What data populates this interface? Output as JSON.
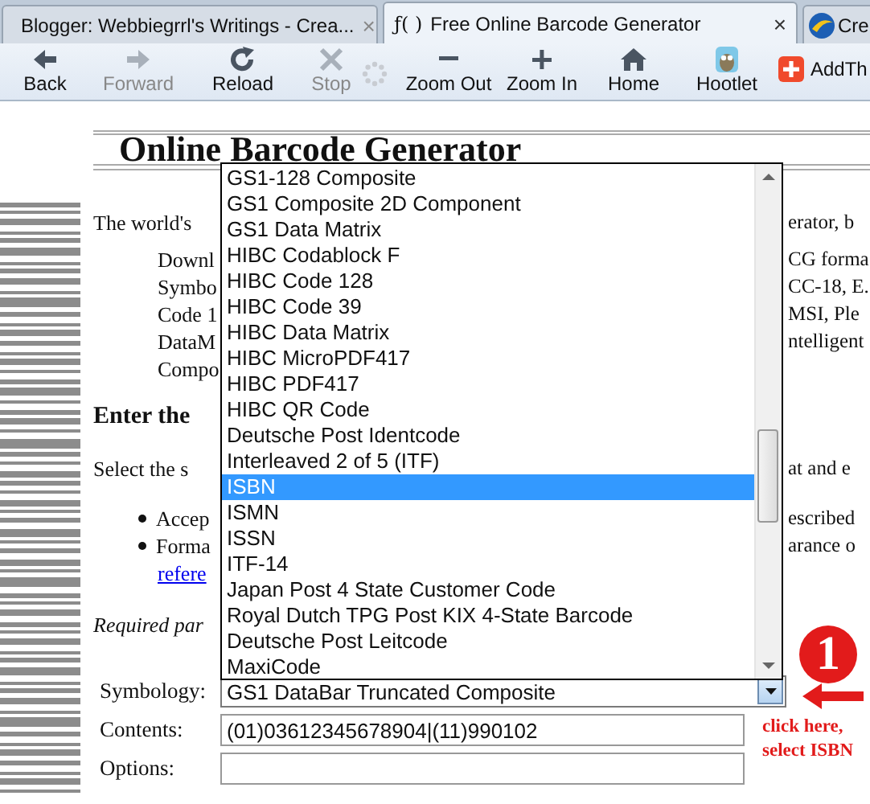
{
  "tabs": [
    {
      "kind": "blogger",
      "title": "Blogger: Webbiegrrl's Writings - Crea...",
      "selected": false,
      "close": "×"
    },
    {
      "kind": "glyph",
      "glyph": "ƒ( )",
      "title": "Free Online Barcode Generator",
      "selected": true,
      "close": "×"
    },
    {
      "kind": "globe",
      "title": "Cre",
      "selected": false
    }
  ],
  "toolbar": [
    {
      "kind": "back",
      "label": "Back",
      "disabled": false
    },
    {
      "kind": "forward",
      "label": "Forward",
      "disabled": true
    },
    {
      "kind": "reload",
      "label": "Reload",
      "disabled": false
    },
    {
      "kind": "stop",
      "label": "Stop",
      "disabled": true
    },
    {
      "kind": "spinner"
    },
    {
      "kind": "zoomout",
      "label": "Zoom Out",
      "disabled": false
    },
    {
      "kind": "zoomin",
      "label": "Zoom In",
      "disabled": false
    },
    {
      "kind": "home",
      "label": "Home",
      "disabled": false
    },
    {
      "kind": "owl",
      "label": "Hootlet",
      "disabled": false
    },
    {
      "kind": "plus",
      "label": "AddTh",
      "disabled": false
    }
  ],
  "page": {
    "heading": "Online Barcode Generator",
    "lines": [
      {
        "kind": "para",
        "left": "The world's",
        "right": "erator, b"
      },
      {
        "kind": "indent",
        "left": "Downl",
        "right": "CG forma"
      },
      {
        "kind": "indent",
        "left": "Symbo",
        "right": "CC-18, E."
      },
      {
        "kind": "indent",
        "left": "Code 1",
        "right": "MSI, Ple"
      },
      {
        "kind": "indent",
        "left": "DataM",
        "right": "ntelligent"
      },
      {
        "kind": "indent",
        "left": "Compo"
      },
      {
        "kind": "bold",
        "left": "Enter the"
      },
      {
        "kind": "para",
        "left": "Select the s",
        "right": "at and e"
      },
      {
        "kind": "bullet",
        "left": "Accep",
        "right": "escribed"
      },
      {
        "kind": "bullet",
        "left": "Forma",
        "right": "arance o"
      },
      {
        "kind": "link",
        "left": "refere"
      },
      {
        "kind": "italic",
        "left": "Required par"
      }
    ],
    "form": [
      {
        "kind": "select",
        "label": "Symbology:",
        "value": "GS1 DataBar Truncated Composite"
      },
      {
        "kind": "text",
        "label": "Contents:",
        "value": "(01)03612345678904|(11)990102"
      },
      {
        "kind": "text",
        "label": "Options:"
      }
    ],
    "dropdown": [
      {
        "label": "GS1-128 Composite",
        "selected": false
      },
      {
        "label": "GS1 Composite 2D Component",
        "selected": false
      },
      {
        "label": "GS1 Data Matrix",
        "selected": false
      },
      {
        "label": "HIBC Codablock F",
        "selected": false
      },
      {
        "label": "HIBC Code 128",
        "selected": false
      },
      {
        "label": "HIBC Code 39",
        "selected": false
      },
      {
        "label": "HIBC Data Matrix",
        "selected": false
      },
      {
        "label": "HIBC MicroPDF417",
        "selected": false
      },
      {
        "label": "HIBC PDF417",
        "selected": false
      },
      {
        "label": "HIBC QR Code",
        "selected": false
      },
      {
        "label": "Deutsche Post Identcode",
        "selected": false
      },
      {
        "label": "Interleaved 2 of 5 (ITF)",
        "selected": false
      },
      {
        "label": "ISBN",
        "selected": true
      },
      {
        "label": "ISMN",
        "selected": false
      },
      {
        "label": "ISSN",
        "selected": false
      },
      {
        "label": "ITF-14",
        "selected": false
      },
      {
        "label": "Japan Post 4 State Customer Code",
        "selected": false
      },
      {
        "label": "Royal Dutch TPG Post KIX 4-State Barcode",
        "selected": false
      },
      {
        "label": "Deutsche Post Leitcode",
        "selected": false
      },
      {
        "label": "MaxiCode",
        "selected": false
      }
    ]
  },
  "annotation": {
    "number": "1",
    "note": "click here,\nselect ISBN"
  }
}
